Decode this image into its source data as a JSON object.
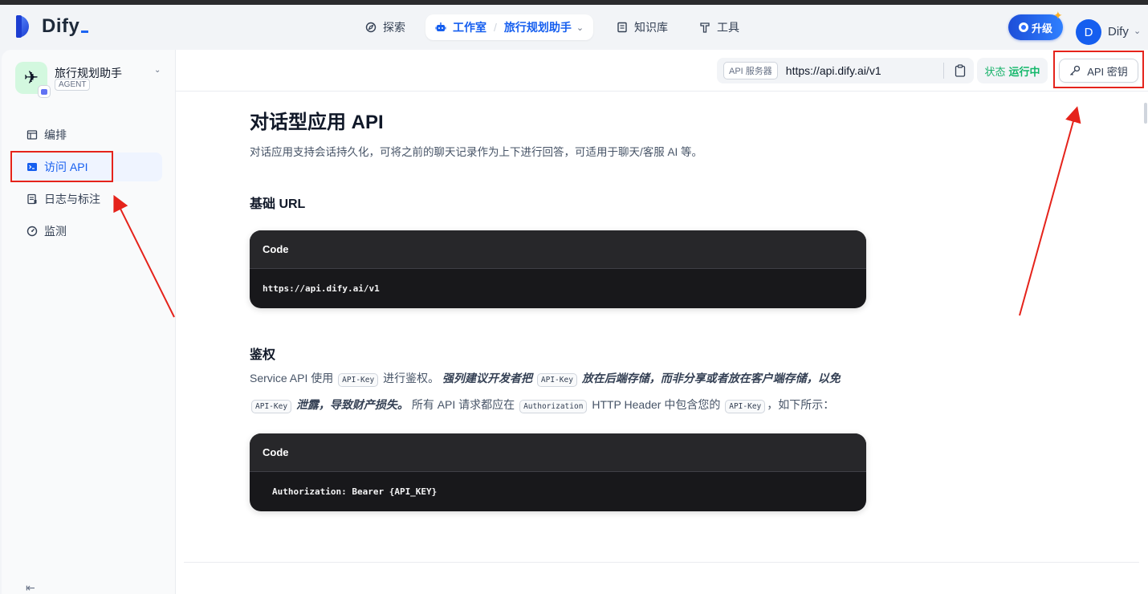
{
  "header": {
    "logo_text": "Dify",
    "nav": {
      "explore": "探索",
      "studio": "工作室",
      "current_app": "旅行规划助手",
      "knowledge": "知识库",
      "tools": "工具"
    },
    "upgrade_label": "升级",
    "avatar_initial": "D",
    "user_name": "Dify"
  },
  "sidebar": {
    "app_name": "旅行规划助手",
    "app_type": "AGENT",
    "items": [
      {
        "label": "编排",
        "icon": "layout-icon"
      },
      {
        "label": "访问 API",
        "icon": "terminal-icon",
        "active": true
      },
      {
        "label": "日志与标注",
        "icon": "file-list-icon"
      },
      {
        "label": "监测",
        "icon": "dashboard-icon"
      }
    ]
  },
  "topbar": {
    "api_server_label": "API 服务器",
    "api_server_url": "https://api.dify.ai/v1",
    "status_label": "状态",
    "status_value": "运行中",
    "api_key_button": "API 密钥"
  },
  "doc": {
    "title": "对话型应用 API",
    "intro": "对话应用支持会话持久化，可将之前的聊天记录作为上下进行回答，可适用于聊天/客服 AI 等。",
    "base_url_heading": "基础 URL",
    "code_label": "Code",
    "base_url_code": "https://api.dify.ai/v1",
    "auth_heading": "鉴权",
    "auth": {
      "p1": "Service API 使用",
      "code_api_key": "API-Key",
      "p2": "进行鉴权。",
      "em1": "强列建议开发者把",
      "em2": "放在后端存储，而非分享或者放在客户端存储，以免",
      "em3": "泄露，导致财产损失。",
      "p3": "所有 API 请求都应在",
      "code_authorization": "Authorization",
      "p4": "HTTP Header 中包含您的",
      "p5": "，如下所示："
    },
    "auth_code": "Authorization: Bearer {API_KEY}"
  },
  "colors": {
    "accent": "#155eef",
    "status_green": "#12b76a",
    "annotation_red": "#e5231b",
    "code_bg": "#18181b"
  }
}
